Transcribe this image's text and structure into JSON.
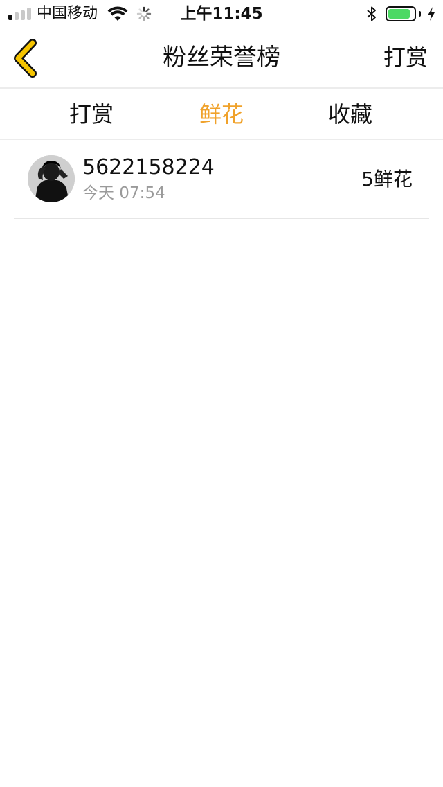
{
  "status_bar": {
    "carrier": "中国移动",
    "time": "上午11:45",
    "signal_bars_filled": 1,
    "signal_bars_total": 4,
    "battery_level": 0.85,
    "battery_color": "#4cd964",
    "icons": [
      "wifi-icon",
      "spinner-icon",
      "bluetooth-icon",
      "battery-icon",
      "charging-bolt-icon"
    ]
  },
  "nav": {
    "back_icon": "chevron-left-icon",
    "back_color": "#f5c400",
    "title": "粉丝荣誉榜",
    "right_action": "打赏"
  },
  "tabs": [
    {
      "label": "打赏",
      "active": false
    },
    {
      "label": "鲜花",
      "active": true
    },
    {
      "label": "收藏",
      "active": false
    }
  ],
  "accent_color": "#f0a22b",
  "fans": [
    {
      "name": "5622158224",
      "time": "今天 07:54",
      "amount": "5鲜花",
      "avatar_icon": "avatar"
    }
  ]
}
